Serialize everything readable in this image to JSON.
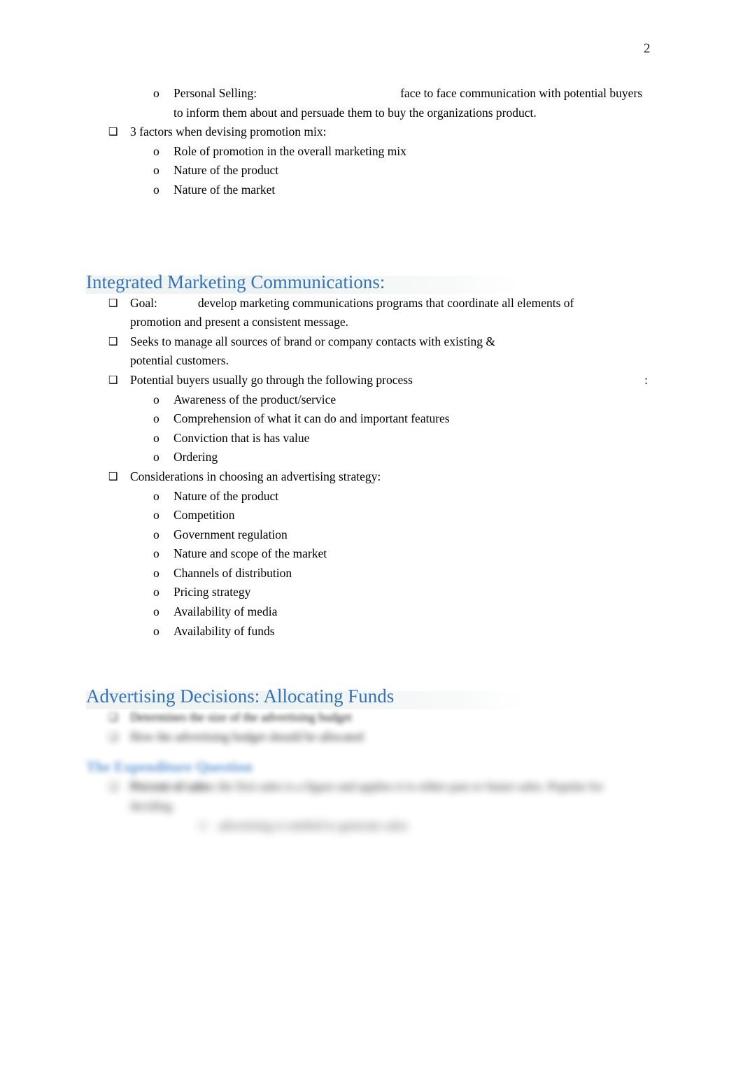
{
  "header": {
    "page_number": "2"
  },
  "colors": {
    "heading_blue": "#3573b9",
    "subheading_blue": "#4f8fd0",
    "body_text": "#000000",
    "page_background": "#ffffff"
  },
  "markers": {
    "level1_bullet": "❑",
    "level2_bullet": "o",
    "level3_bullet": "❑"
  },
  "sections": {
    "promotion_mix": {
      "personal_selling": {
        "label": "Personal Selling:",
        "description": "face to face communication with potential buyers to inform them about and persuade them to buy the organizations product."
      },
      "factors_heading": "3 factors when devising promotion mix:",
      "factors": [
        "Role of promotion in the overall marketing mix",
        "Nature of the product",
        "Nature of the market"
      ]
    },
    "imc": {
      "heading": "Integrated Marketing Communications:",
      "goal_label": "Goal:",
      "goal_text": "develop marketing communications programs that coordinate all elements of promotion and present a consistent message.",
      "seeks_text": "Seeks to manage all sources of brand or company contacts with existing & potential customers.",
      "process_text": "Potential buyers usually go through the following process",
      "process_trailing": ":",
      "process_steps": [
        "Awareness of the product/service",
        "Comprehension of what it can do and important features",
        "Conviction that is has value",
        "Ordering"
      ],
      "considerations_heading": "Considerations in choosing an advertising strategy:",
      "considerations": [
        "Nature of the product",
        "Competition",
        "Government regulation",
        "Nature and scope of the market",
        "Channels of distribution",
        "Pricing strategy",
        "Availability of media",
        "Availability of funds"
      ]
    },
    "allocating_funds": {
      "heading": "Advertising Decisions: Allocating Funds",
      "points": [
        "Determines the size of the advertising budget",
        "How the advertising budget should be allocated"
      ],
      "subheading": "The Expenditure Question",
      "detail_label": "Percent of sales:",
      "detail_text": "the first sales is a figure and applies it to either past or future sales. Popular for deciding",
      "detail_sub": "advertising is entitled to generate sales"
    }
  }
}
